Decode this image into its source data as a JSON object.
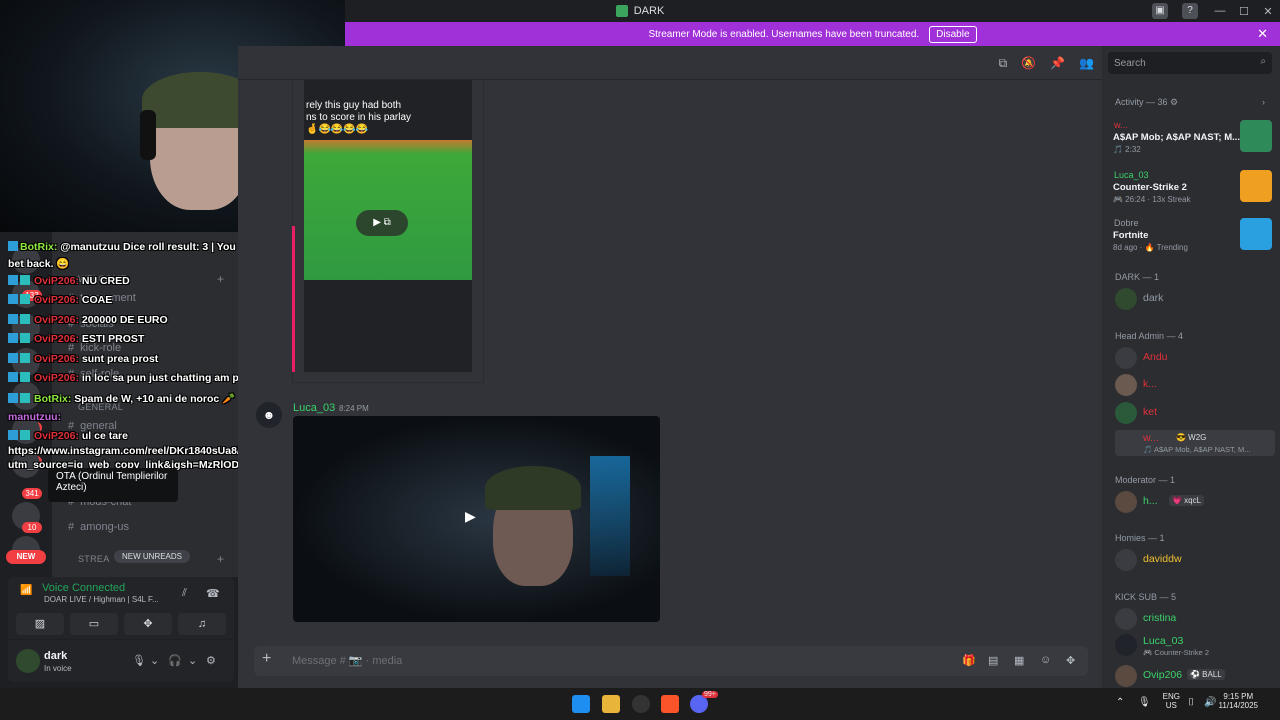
{
  "window": {
    "title": "DARK"
  },
  "banner": {
    "text": "Streamer Mode is enabled. Usernames have been truncated.",
    "disable_label": "Disable",
    "close": "✕"
  },
  "overlay_chat": [
    {
      "text": "@manutzuu Dice roll result: 3 | You got half of the",
      "user": "BotRix:",
      "user_color": "green"
    },
    {
      "text": "bet back. 😄"
    },
    {
      "user": "OviP206:",
      "text": "NU CRED",
      "user_color": "red"
    },
    {
      "user": "OviP206:",
      "text": "COAE",
      "user_color": "red"
    },
    {
      "user": "OviP206:",
      "text": "200000 DE EURO",
      "user_color": "red"
    },
    {
      "user": "OviP206:",
      "text": "ESTI PROST",
      "user_color": "red"
    },
    {
      "user": "OviP206:",
      "text": "sunt prea prost",
      "user_color": "red"
    },
    {
      "user": "OviP206:",
      "text": "in loc sa pun just chatting am pus tot cs",
      "user_color": "red"
    },
    {
      "user": "BotRix:",
      "text": "Spam de W, +10 ani de noroc 🥕",
      "user_color": "green"
    },
    {
      "user": "manutzuu:",
      "text": "",
      "user_color": "purple"
    },
    {
      "user": "OviP206:",
      "text": "ul ce tare",
      "user_color": "red"
    },
    {
      "text": "https://www.instagram.com/reel/DKr1840sUa8/?"
    },
    {
      "text": "utm_source=ig_web_copy_link&igsh=MzRlODBiNWFlZA=="
    }
  ],
  "servers": {
    "badges": [
      "133",
      "65",
      "27",
      "341",
      "10"
    ],
    "new_label": "NEW"
  },
  "channels": {
    "categories": [
      "WELCOME",
      "GENERAL",
      "STREA"
    ],
    "items": [
      "tournament",
      "socials",
      "kick-role",
      "self-role",
      "general",
      "mods-chat",
      "among-us"
    ],
    "new_unreads": "NEW UNREADS",
    "tooltip": "OTA (Ordinul Templierilor Azteci)"
  },
  "voice": {
    "status": "Voice Connected",
    "channel": "DOAR LIVE / Highman | S4L F..."
  },
  "user": {
    "name": "dark",
    "status": "In voice"
  },
  "embed": {
    "caption": "rely this guy had both\nns to score in his parlay\n🤞😂😂😂😂"
  },
  "message": {
    "author": "Luca_03",
    "time": "8:24 PM"
  },
  "composer": {
    "placeholder": "Message # 📷 · media"
  },
  "members": {
    "search_placeholder": "Search",
    "activity_header": "Activity — 36 ⚙",
    "activities": [
      {
        "user": "w...",
        "title": "A$AP Mob; A$AP NAST; M...",
        "meta": "🎵 2:32",
        "thumb_color": "#2f8a5a"
      },
      {
        "user": "Luca_03",
        "title": "Counter-Strike 2",
        "meta": "🎮 26:24 · 13x Streak",
        "thumb_color": "#f0a020"
      },
      {
        "user": "Dobre",
        "title": "Fortnite",
        "meta": "8d ago · 🔥 Trending",
        "thumb_color": "#2aa0e0"
      }
    ],
    "groups": [
      {
        "header": "DARK — 1",
        "members": [
          {
            "name": "dark",
            "color": "#949ba4",
            "tag": "",
            "sub": ""
          }
        ]
      },
      {
        "header": "Head Admin — 4",
        "members": [
          {
            "name": "Andu",
            "color": "#e0303a",
            "tag": "",
            "sub": ""
          },
          {
            "name": "k...",
            "color": "#e0303a",
            "tag": "",
            "sub": ""
          },
          {
            "name": "ket",
            "color": "#e0303a",
            "tag": "",
            "sub": ""
          },
          {
            "name": "w...",
            "color": "#e0303a",
            "tag": "😎 W2G",
            "sub": "🎵 A$AP Mob, A$AP NAST, M..."
          }
        ]
      },
      {
        "header": "Moderator — 1",
        "members": [
          {
            "name": "h...",
            "color": "#3bd36a",
            "tag": "💗 xqcL",
            "sub": ""
          }
        ]
      },
      {
        "header": "Homies — 1",
        "members": [
          {
            "name": "daviddw",
            "color": "#f0c030",
            "tag": "",
            "sub": ""
          }
        ]
      },
      {
        "header": "KICK SUB — 5",
        "members": [
          {
            "name": "cristina",
            "color": "#3bd36a",
            "tag": "",
            "sub": ""
          },
          {
            "name": "Luca_03",
            "color": "#3bd36a",
            "tag": "",
            "sub": "🎮 Counter-Strike 2"
          },
          {
            "name": "Ovip206",
            "color": "#3bd36a",
            "tag": "⚽ BALL",
            "sub": ""
          }
        ]
      }
    ]
  },
  "taskbar": {
    "lang": "ENG",
    "region": "US",
    "time": "9:15 PM",
    "date": "11/14/2025",
    "discord_badge": "99+"
  }
}
